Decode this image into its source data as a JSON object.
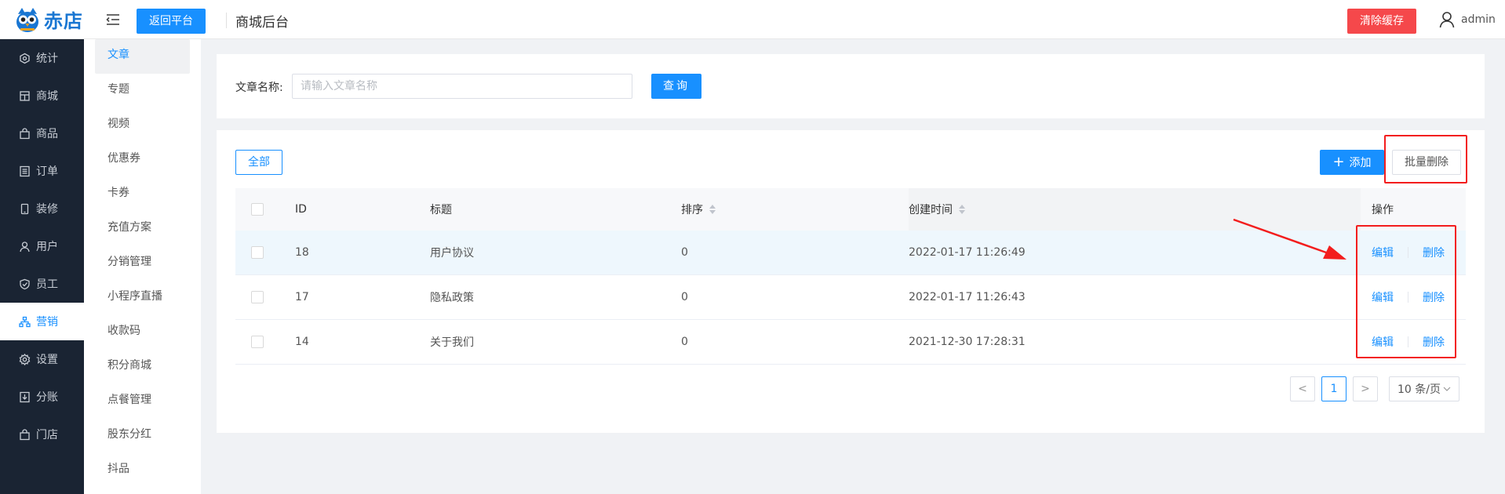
{
  "header": {
    "logo_text": "赤店",
    "back_button": "返回平台",
    "title": "商城后台",
    "clear_cache_button": "清除缓存",
    "user_name": "admin"
  },
  "sidebar": {
    "items": [
      {
        "label": "统计",
        "icon": "pie-icon"
      },
      {
        "label": "商城",
        "icon": "store-icon"
      },
      {
        "label": "商品",
        "icon": "bag-icon"
      },
      {
        "label": "订单",
        "icon": "list-icon"
      },
      {
        "label": "装修",
        "icon": "phone-icon"
      },
      {
        "label": "用户",
        "icon": "user-icon"
      },
      {
        "label": "员工",
        "icon": "shield-icon"
      },
      {
        "label": "营销",
        "icon": "network-icon",
        "active": true
      },
      {
        "label": "设置",
        "icon": "gear-icon"
      },
      {
        "label": "分账",
        "icon": "download-icon"
      },
      {
        "label": "门店",
        "icon": "bag-icon"
      }
    ]
  },
  "subnav": {
    "items": [
      "文章",
      "专题",
      "视频",
      "优惠券",
      "卡券",
      "充值方案",
      "分销管理",
      "小程序直播",
      "收款码",
      "积分商城",
      "点餐管理",
      "股东分红",
      "抖品"
    ],
    "active_index": 0
  },
  "search": {
    "label": "文章名称:",
    "placeholder": "请输入文章名称",
    "value": "",
    "button": "查询"
  },
  "toolbar": {
    "all_button": "全部",
    "add_button": "添加",
    "batch_delete_button": "批量删除"
  },
  "table": {
    "columns": [
      "ID",
      "标题",
      "排序",
      "创建时间",
      "操作"
    ],
    "rows": [
      {
        "id": "18",
        "title": "用户协议",
        "sort": "0",
        "created": "2022-01-17 11:26:49",
        "edit": "编辑",
        "delete": "删除"
      },
      {
        "id": "17",
        "title": "隐私政策",
        "sort": "0",
        "created": "2022-01-17 11:26:43",
        "edit": "编辑",
        "delete": "删除"
      },
      {
        "id": "14",
        "title": "关于我们",
        "sort": "0",
        "created": "2021-12-30 17:28:31",
        "edit": "编辑",
        "delete": "删除"
      }
    ]
  },
  "pagination": {
    "prev": "<",
    "current": "1",
    "next": ">",
    "page_size": "10 条/页"
  },
  "colors": {
    "primary": "#1890ff",
    "danger": "#f5484b",
    "sidebar_bg": "#1a2433",
    "annotation_red": "#f31d1d"
  }
}
